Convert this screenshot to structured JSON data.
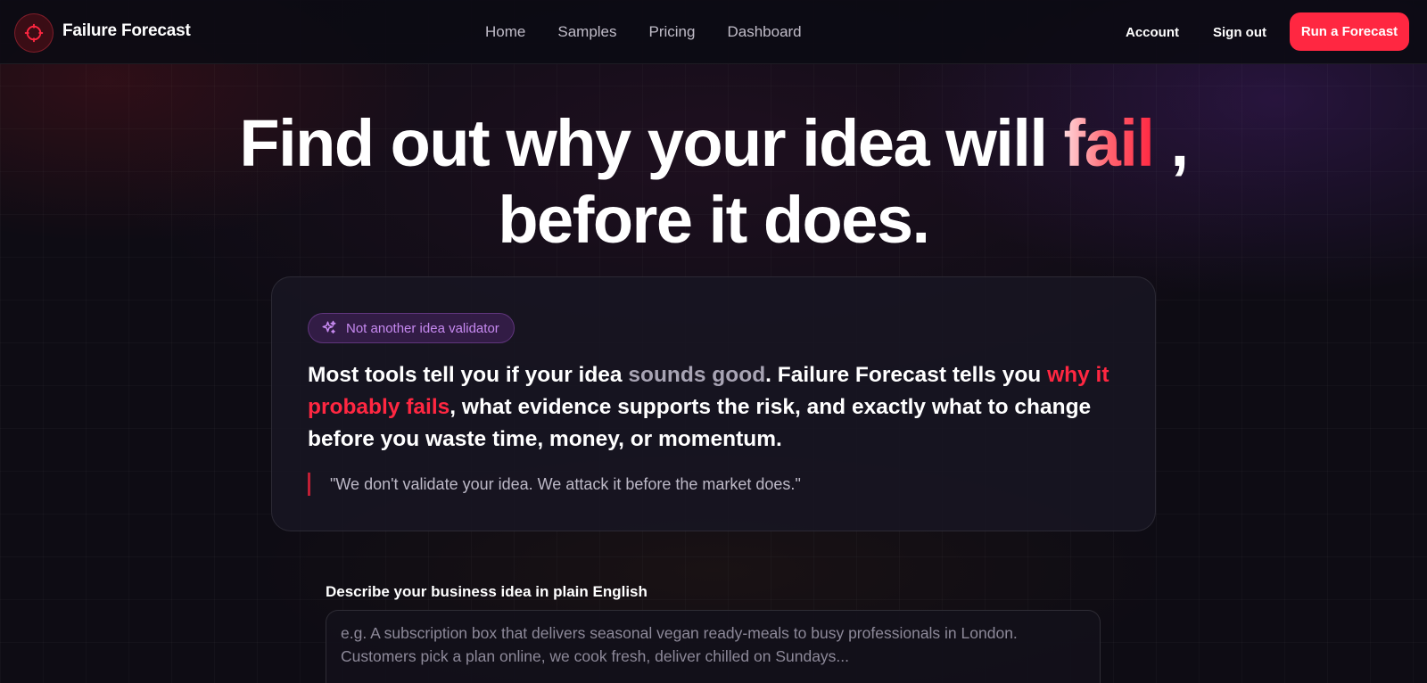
{
  "nav": {
    "brand": "Failure Forecast",
    "links": [
      "Home",
      "Samples",
      "Pricing",
      "Dashboard"
    ],
    "account": "Account",
    "sign_out": "Sign out",
    "cta": "Run a Forecast",
    "logo_icon": "crosshair-icon",
    "accent_color": "#ff2741"
  },
  "hero": {
    "line1_before": "Find out why your idea will ",
    "line1_accent": "fail",
    "line1_after": " ,",
    "line2": "before it does."
  },
  "card": {
    "badge_icon": "sparkles-icon",
    "badge": "Not another idea validator",
    "text_part1": "Most tools tell you if your idea ",
    "text_muted": "sounds good",
    "text_part2": ". Failure Forecast tells you ",
    "text_red": "why it probably fails",
    "text_part3": ", what evidence supports the risk, and exactly what to change before you waste time, money, or momentum.",
    "quote": "\"We don't validate your idea. We attack it before the market does.\""
  },
  "form": {
    "label": "Describe your business idea in plain English",
    "placeholder": "e.g. A subscription box that delivers seasonal vegan ready-meals to busy professionals in London. Customers pick a plan online, we cook fresh, deliver chilled on Sundays...",
    "value": ""
  }
}
